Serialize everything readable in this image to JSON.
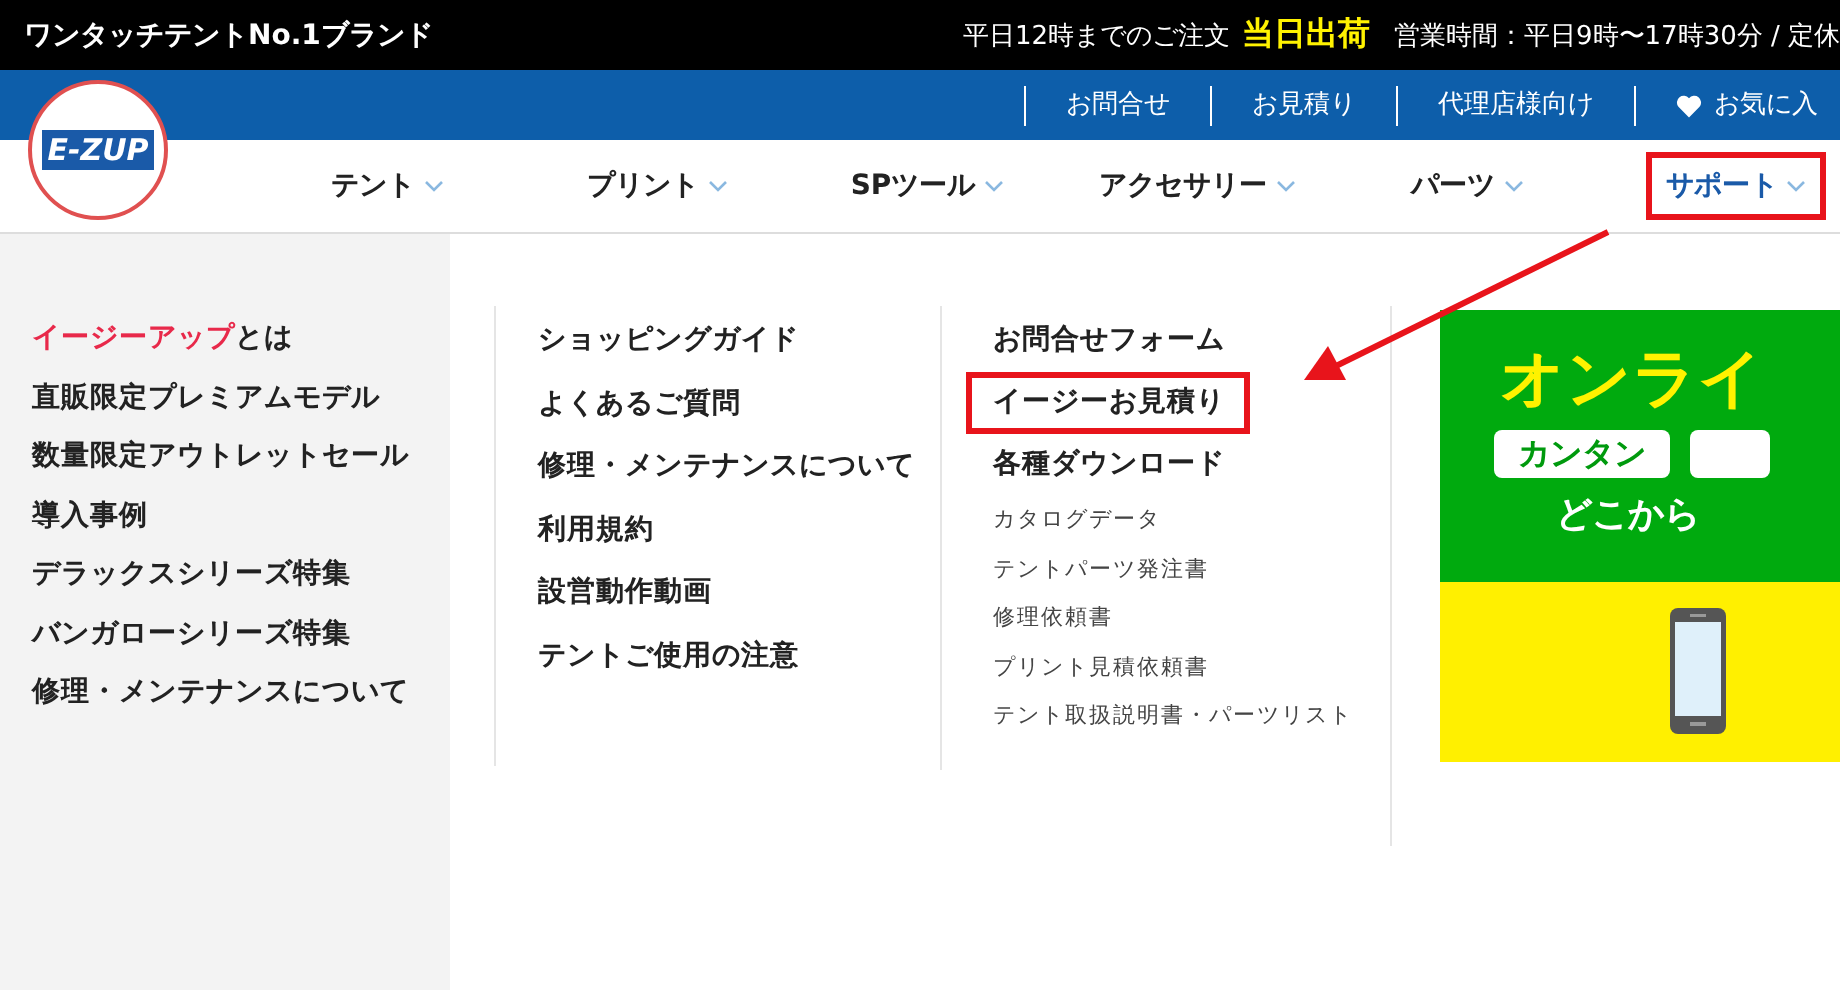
{
  "top_bar": {
    "tagline": "ワンタッチテントNo.1ブランド",
    "order_note": "平日12時までのご注文",
    "same_day": "当日出荷",
    "hours": "営業時間：平日9時〜17時30分 / 定休"
  },
  "utility_links": [
    {
      "label": "お問合せ",
      "kind": "link"
    },
    {
      "label": "お見積り",
      "kind": "link"
    },
    {
      "label": "代理店様向け",
      "kind": "link"
    },
    {
      "label": "お気に入",
      "kind": "favorite"
    }
  ],
  "logo": {
    "text": "E-ZUP"
  },
  "nav": [
    {
      "label": "テント",
      "selected": false,
      "highlighted": false
    },
    {
      "label": "プリント",
      "selected": false,
      "highlighted": false
    },
    {
      "label": "SPツール",
      "selected": false,
      "highlighted": false
    },
    {
      "label": "アクセサリー",
      "selected": false,
      "highlighted": false
    },
    {
      "label": "パーツ",
      "selected": false,
      "highlighted": false
    },
    {
      "label": "サポート",
      "selected": true,
      "highlighted": true
    }
  ],
  "sidebar": [
    {
      "accent": "イージーアップ",
      "label": "とは"
    },
    {
      "label": "直販限定プレミアムモデル"
    },
    {
      "label": "数量限定アウトレットセール"
    },
    {
      "label": "導入事例"
    },
    {
      "label": "デラックスシリーズ特集"
    },
    {
      "label": "バンガローシリーズ特集"
    },
    {
      "label": "修理・メンテナンスについて"
    }
  ],
  "guide_links": [
    "ショッピングガイド",
    "よくあるご質問",
    "修理・メンテナンスについて",
    "利用規約",
    "設営動作動画",
    "テントご使用の注意"
  ],
  "support_links": [
    {
      "label": "お問合せフォーム",
      "kind": "heading",
      "highlighted": false
    },
    {
      "label": "イージーお見積り",
      "kind": "heading",
      "highlighted": true
    },
    {
      "label": "各種ダウンロード",
      "kind": "heading",
      "highlighted": false
    },
    {
      "label": "カタログデータ",
      "kind": "link",
      "highlighted": false
    },
    {
      "label": "テントパーツ発注書",
      "kind": "link",
      "highlighted": false
    },
    {
      "label": "修理依頼書",
      "kind": "link",
      "highlighted": false
    },
    {
      "label": "プリント見積依頼書",
      "kind": "link",
      "highlighted": false
    },
    {
      "label": "テント取扱説明書・パーツリスト",
      "kind": "link",
      "highlighted": false
    }
  ],
  "banner": {
    "headline": "オンライ",
    "tag": "カンタン",
    "subline": "どこから"
  },
  "annotation": {
    "arrow": true
  }
}
